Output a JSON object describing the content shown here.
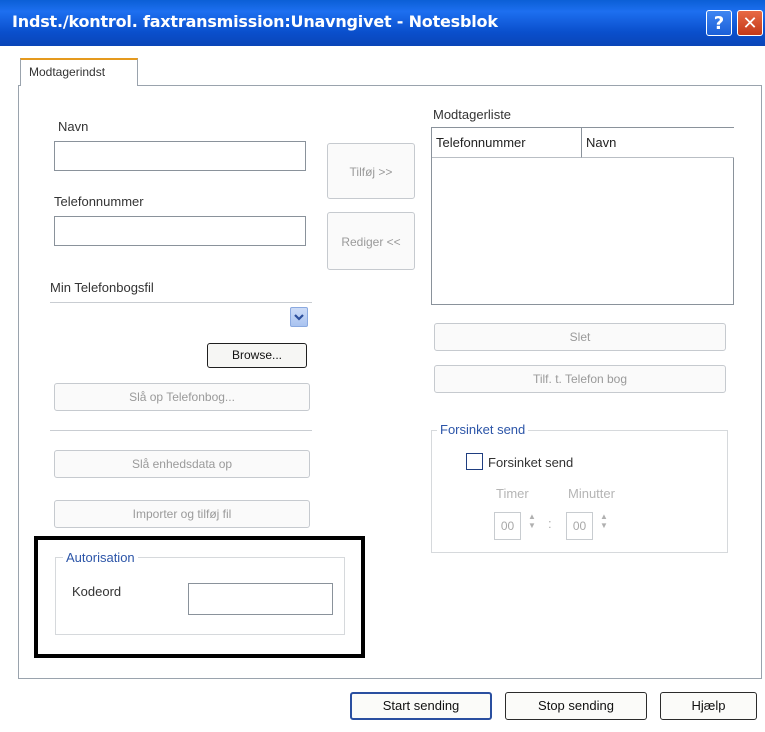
{
  "window": {
    "title": "Indst./kontrol. faxtransmission:Unavngivet - Notesblok",
    "help_symbol": "?",
    "close_symbol": "✕"
  },
  "tabs": [
    {
      "label": "Modtagerindst",
      "selected": true
    }
  ],
  "form": {
    "name_label": "Navn",
    "name_value": "",
    "phone_label": "Telefonnummer",
    "phone_value": "",
    "phonebook_label": "Min Telefonbogsfil",
    "phonebook_value": "",
    "browse_button": "Browse...",
    "lookup_phonebook_button": "Slå op Telefonbog...",
    "lookup_device_button": "Slå enhedsdata op",
    "import_button": "Importer og tilføj fil"
  },
  "middle": {
    "add_button": "Tilføj >>",
    "edit_button": "Rediger <<"
  },
  "recipients": {
    "label": "Modtagerliste",
    "columns": [
      "Telefonnummer",
      "Navn"
    ],
    "rows": [],
    "delete_button": "Slet",
    "add_to_phonebook_button": "Tilf. t. Telefon bog"
  },
  "delayed": {
    "group_title": "Forsinket send",
    "checkbox_label": "Forsinket send",
    "checked": false,
    "hours_label": "Timer",
    "minutes_label": "Minutter",
    "hours_value": "00",
    "minutes_value": "00",
    "separator": ":"
  },
  "auth": {
    "group_title": "Autorisation",
    "password_label": "Kodeord",
    "password_value": ""
  },
  "footer": {
    "start_button": "Start sending",
    "stop_button": "Stop sending",
    "help_button": "Hjælp"
  },
  "icons": {
    "dropdown_arrow": "chevron-down-icon",
    "spin_arrows": "spin-arrows-icon"
  },
  "colors": {
    "titlebar": "#0a4fcc",
    "group_title": "#2c55a8",
    "tab_highlight": "#e59a1e",
    "close_button": "#c3391a"
  }
}
